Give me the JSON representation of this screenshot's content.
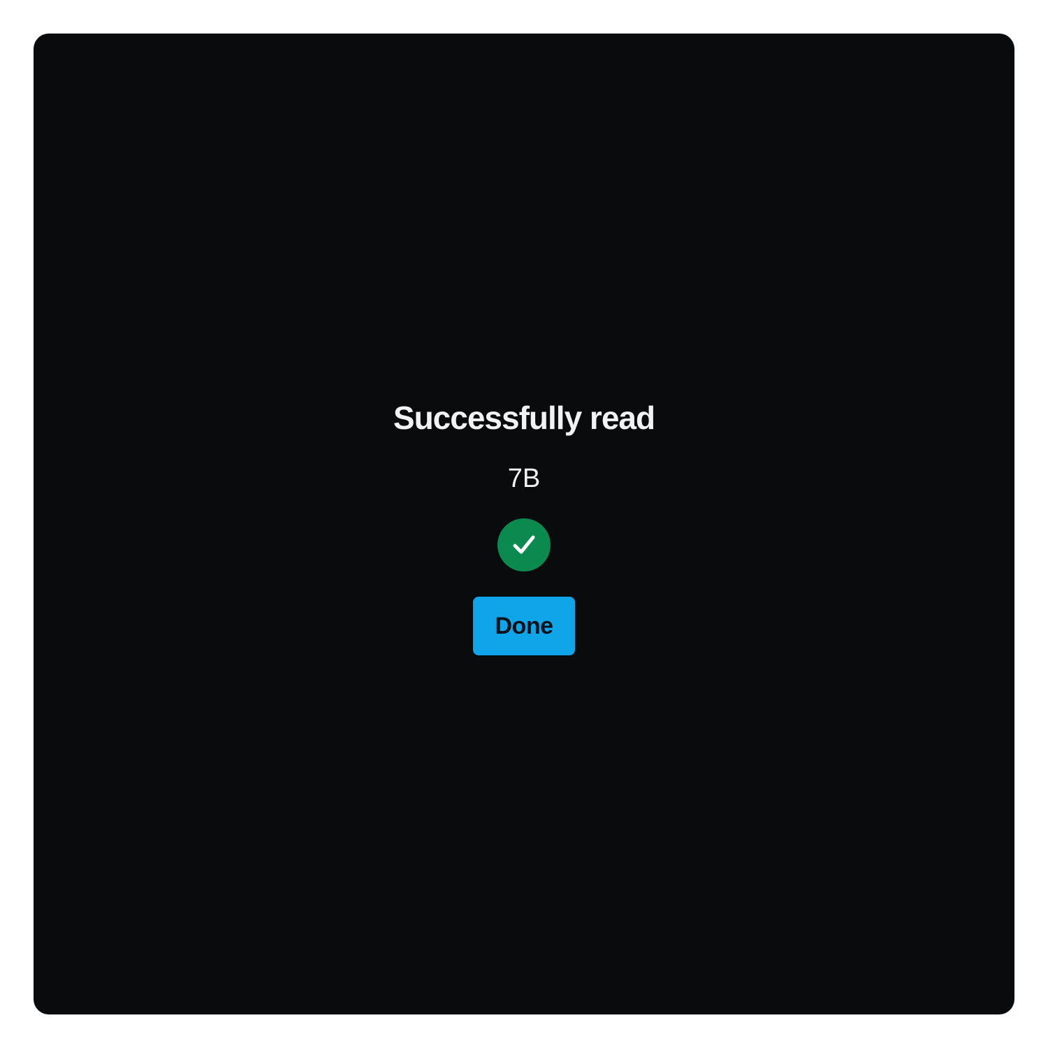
{
  "dialog": {
    "title": "Successfully read",
    "size_text": "7B",
    "status_icon": "check-circle-icon",
    "done_label": "Done"
  },
  "colors": {
    "background": "#0a0b0d",
    "success": "#0b8a4f",
    "accent": "#10a5e8",
    "text": "#f2f2f2"
  }
}
